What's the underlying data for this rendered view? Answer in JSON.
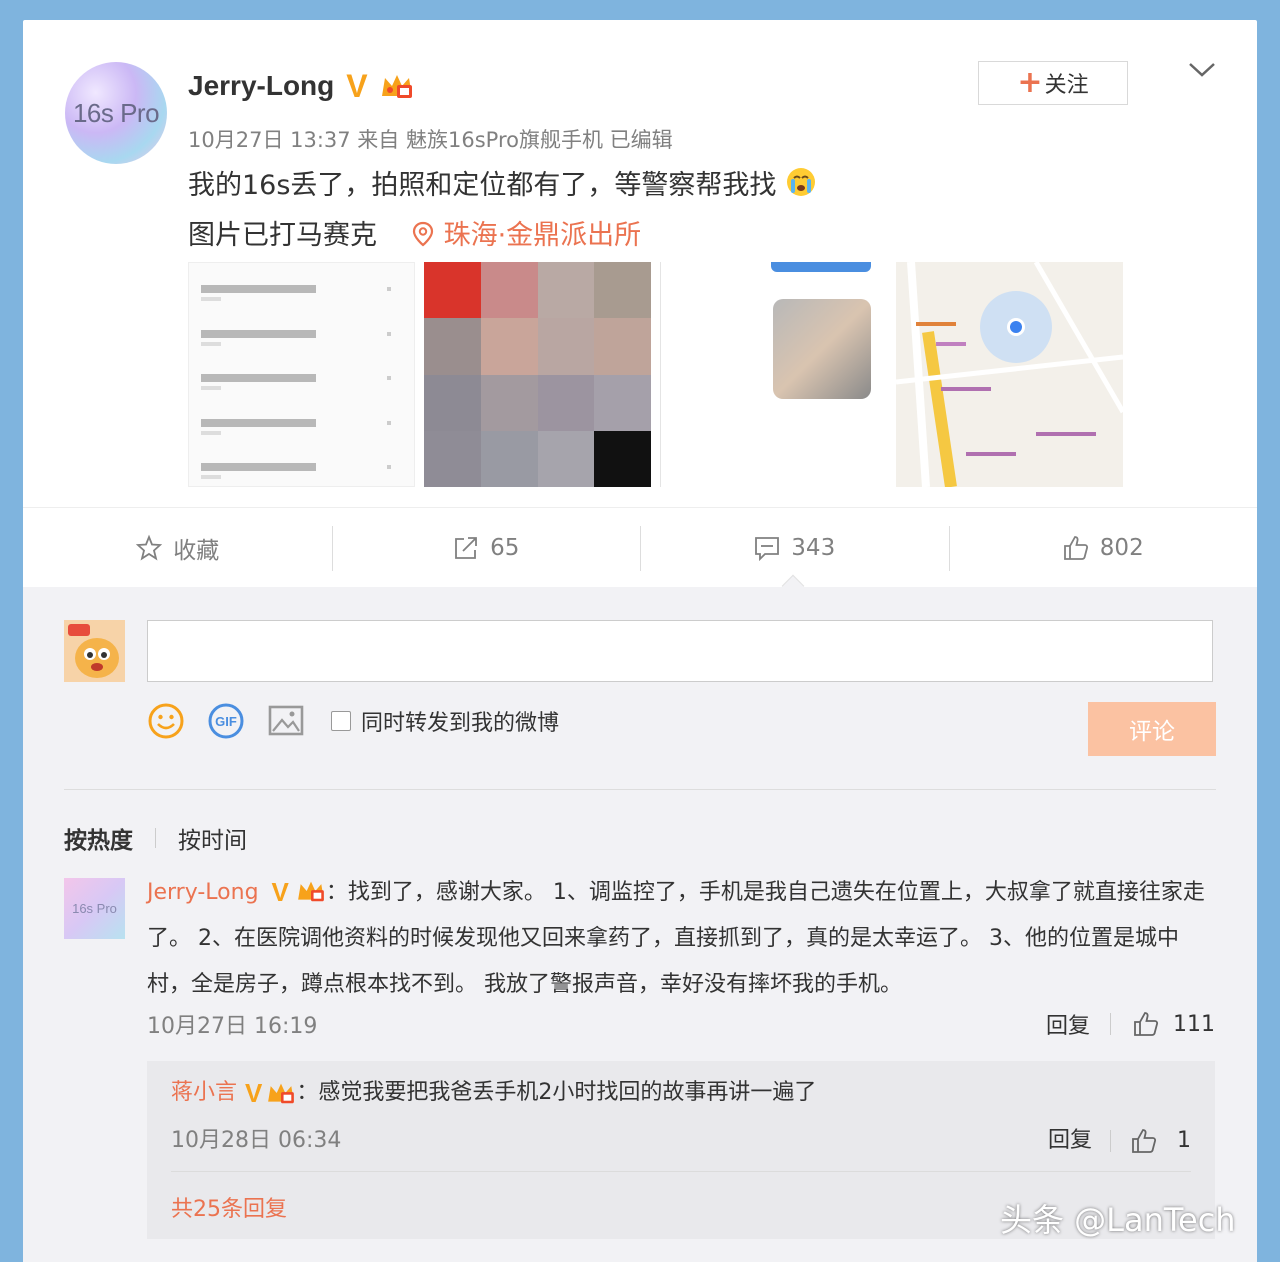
{
  "post": {
    "avatar_text": "16s Pro",
    "author": "Jerry-Long",
    "verified_badge": "V",
    "meta": "10月27日 13:37 来自 魅族16sPro旗舰手机   已编辑",
    "text_line1": "我的16s丢了，拍照和定位都有了，等警察帮我找",
    "text_line2": "图片已打马赛克",
    "location": "珠海·金鼎派出所",
    "follow_label": "关注",
    "follow_plus": "+"
  },
  "actions": {
    "favorite": "收藏",
    "repost_count": "65",
    "comment_count": "343",
    "like_count": "802"
  },
  "composer": {
    "repost_checkbox_label": "同时转发到我的微博",
    "submit_label": "评论"
  },
  "sort": {
    "hot": "按热度",
    "time": "按时间"
  },
  "comment": {
    "avatar_text": "16s Pro",
    "author": "Jerry-Long",
    "badge": "V",
    "text": "：找到了，感谢大家。 1、调监控了，手机是我自己遗失在位置上，大叔拿了就直接往家走了。 2、在医院调他资料的时候发现他又回来拿药了，直接抓到了，真的是太幸运了。 3、他的位置是城中村，全是房子，蹲点根本找不到。 我放了警报声音，幸好没有摔坏我的手机。",
    "time": "10月27日 16:19",
    "reply_label": "回复",
    "like_count": "111"
  },
  "reply": {
    "author": "蒋小言",
    "badge": "V",
    "text": "：感觉我要把我爸丢手机2小时找回的故事再讲一遍了",
    "time": "10月28日 06:34",
    "reply_label": "回复",
    "like_count": "1",
    "more_label": "共25条回复"
  },
  "watermark": "头条 @LanTech",
  "colors": {
    "accent": "#eb7350",
    "verified": "#f7a21b",
    "page_bg": "#7fb4de",
    "submit_disabled": "#fbc2a2"
  }
}
